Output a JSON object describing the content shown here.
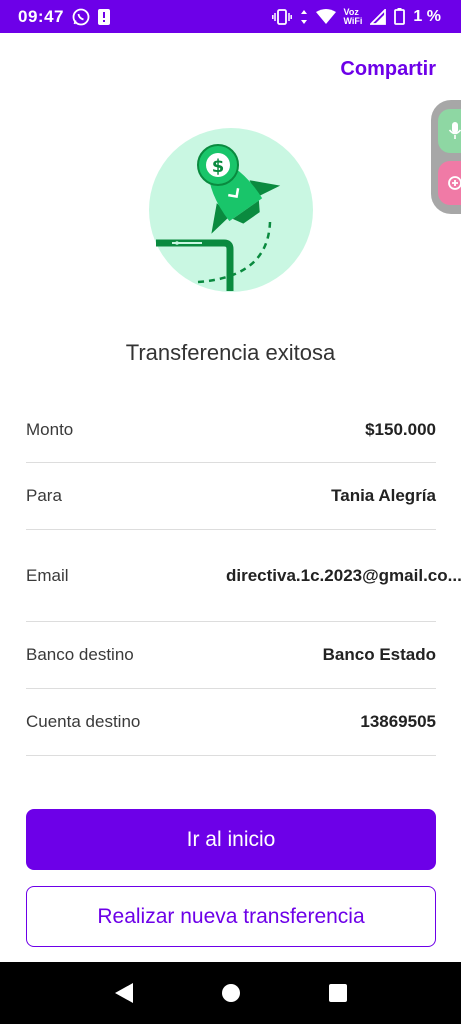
{
  "status_bar": {
    "time": "09:47",
    "network_label_top": "Voz",
    "network_label_bottom": "WiFi",
    "battery_percent": "1 %"
  },
  "header": {
    "share_label": "Compartir"
  },
  "illustration": {
    "icon": "rocket-money-icon",
    "currency_symbol": "$",
    "circle_color": "#c9f7e2",
    "accent_color": "#0aa14b"
  },
  "result": {
    "title": "Transferencia exitosa"
  },
  "details": {
    "monto": {
      "label": "Monto",
      "value": "$150.000"
    },
    "para": {
      "label": "Para",
      "value": "Tania Alegría"
    },
    "email": {
      "label": "Email",
      "value": "directiva.1c.2023@gmail.co..."
    },
    "banco": {
      "label": "Banco destino",
      "value": "Banco Estado"
    },
    "cuenta": {
      "label": "Cuenta destino",
      "value": "13869505"
    }
  },
  "actions": {
    "home_label": "Ir al inicio",
    "new_transfer_label": "Realizar nueva transferencia"
  },
  "colors": {
    "brand": "#6d00e8",
    "divider": "#dddddd"
  }
}
